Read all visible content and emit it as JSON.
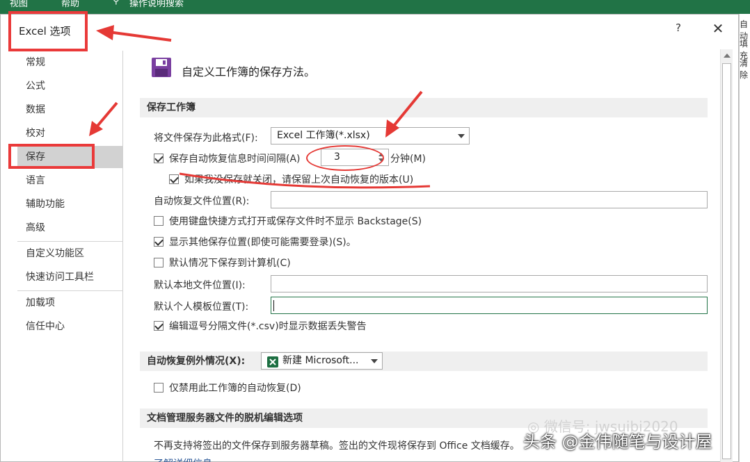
{
  "background_app": {
    "ribbon_fragments": [
      "视图",
      "帮助",
      "操作说明搜索"
    ],
    "right_edge_fragments": [
      "自动",
      "填充",
      "清除"
    ]
  },
  "dialog": {
    "title": "Excel 选项",
    "help_label": "?",
    "close_label": "✕"
  },
  "nav": {
    "items": [
      {
        "label": "常规",
        "active": false
      },
      {
        "label": "公式",
        "active": false
      },
      {
        "label": "数据",
        "active": false
      },
      {
        "label": "校对",
        "active": false
      },
      {
        "label": "保存",
        "active": true
      },
      {
        "label": "语言",
        "active": false
      },
      {
        "label": "辅助功能",
        "active": false
      },
      {
        "label": "高级",
        "active": false
      },
      {
        "label": "自定义功能区",
        "active": false
      },
      {
        "label": "快速访问工具栏",
        "active": false
      },
      {
        "label": "加载项",
        "active": false
      },
      {
        "label": "信任中心",
        "active": false
      }
    ]
  },
  "content": {
    "heading": "自定义工作簿的保存方法。",
    "save_workbooks": {
      "section_title": "保存工作簿",
      "format_label": "将文件保存为此格式(F):",
      "format_value": "Excel 工作簿(*.xlsx)",
      "autorecover_label": "保存自动恢复信息时间间隔(A)",
      "autorecover_checked": true,
      "autorecover_minutes": "3",
      "minutes_label": "分钟(M)",
      "keep_last_label": "如果我没保存就关闭，请保留上次自动恢复的版本(U)",
      "keep_last_checked": true,
      "autorecover_location_label": "自动恢复文件位置(R):",
      "autorecover_location_value": "",
      "no_backstage_label": "使用键盘快捷方式打开或保存文件时不显示 Backstage(S)",
      "no_backstage_checked": false,
      "show_other_label": "显示其他保存位置(即使可能需要登录)(S)。",
      "show_other_checked": true,
      "save_to_computer_label": "默认情况下保存到计算机(C)",
      "save_to_computer_checked": false,
      "default_local_label": "默认本地文件位置(I):",
      "default_local_value": "",
      "default_template_label": "默认个人模板位置(T):",
      "default_template_value": "",
      "csv_warning_label": "编辑逗号分隔文件(*.csv)时显示数据丢失警告",
      "csv_warning_checked": true
    },
    "autorecover_exceptions": {
      "section_title": "自动恢复例外情况(X):",
      "workbook_value": "新建 Microsoft...",
      "disable_label": "仅禁用此工作簿的自动恢复(D)",
      "disable_checked": false
    },
    "offline_editing": {
      "section_title": "文档管理服务器文件的脱机编辑选项",
      "notice": "不再支持将签出的文件保存到服务器草稿。签出的文件现将保存到 Office 文档缓存。",
      "learn_more": "了解详细信息"
    }
  },
  "watermarks": {
    "wechat": "微信号: jwsuibi2020",
    "toutiao": "头条 @金伟随笔与设计屋"
  },
  "colors": {
    "excel_green": "#217346",
    "annotation_red": "#e53935",
    "nav_active_bg": "#d2d2d2",
    "section_bg": "#efefef"
  }
}
